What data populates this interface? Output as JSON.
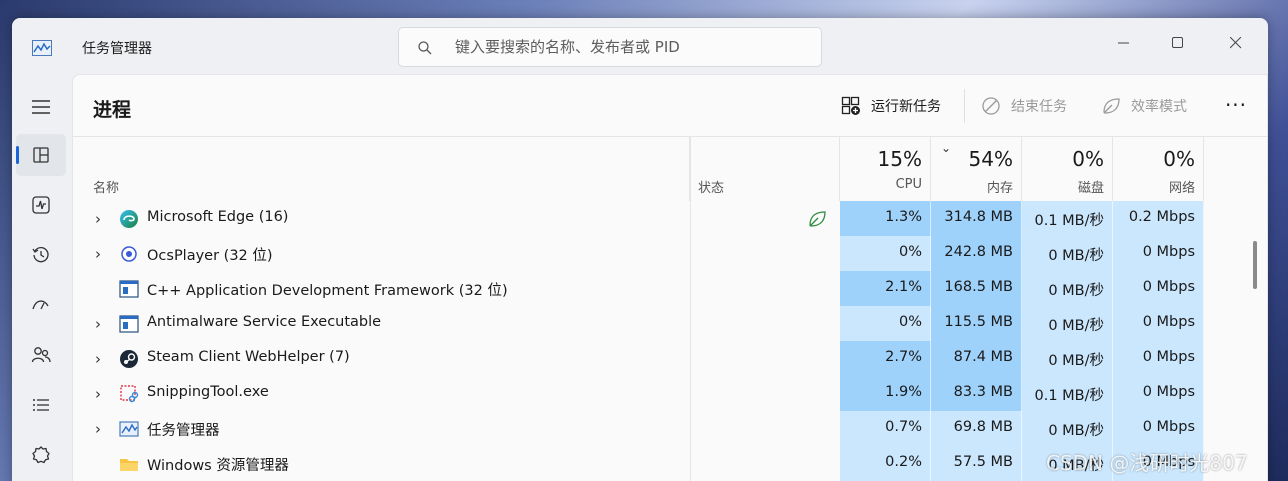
{
  "app": {
    "title": "任务管理器"
  },
  "search": {
    "placeholder": "键入要搜索的名称、发布者或 PID"
  },
  "page": {
    "title": "进程"
  },
  "toolbar": {
    "run_new_task": "运行新任务",
    "end_task": "结束任务",
    "efficiency_mode": "效率模式",
    "more": "···"
  },
  "columns": {
    "name": "名称",
    "status": "状态",
    "cpu": {
      "pct": "15%",
      "label": "CPU"
    },
    "memory": {
      "pct": "54%",
      "label": "内存"
    },
    "disk": {
      "pct": "0%",
      "label": "磁盘"
    },
    "network": {
      "pct": "0%",
      "label": "网络"
    }
  },
  "processes": [
    {
      "name": "Microsoft Edge (16)",
      "icon": "edge-icon",
      "expandable": true,
      "status": "efficiency-leaf-icon",
      "cpu": "1.3%",
      "memory": "314.8 MB",
      "disk": "0.1 MB/秒",
      "network": "0.2 Mbps"
    },
    {
      "name": "OcsPlayer (32 位)",
      "icon": "ocsplayer-icon",
      "expandable": true,
      "status": "",
      "cpu": "0%",
      "memory": "242.8 MB",
      "disk": "0 MB/秒",
      "network": "0 Mbps"
    },
    {
      "name": "C++ Application Development Framework (32 位)",
      "icon": "window-icon",
      "expandable": false,
      "status": "",
      "cpu": "2.1%",
      "memory": "168.5 MB",
      "disk": "0 MB/秒",
      "network": "0 Mbps"
    },
    {
      "name": "Antimalware Service Executable",
      "icon": "window-icon",
      "expandable": true,
      "status": "",
      "cpu": "0%",
      "memory": "115.5 MB",
      "disk": "0 MB/秒",
      "network": "0 Mbps"
    },
    {
      "name": "Steam Client WebHelper (7)",
      "icon": "steam-icon",
      "expandable": true,
      "status": "",
      "cpu": "2.7%",
      "memory": "87.4 MB",
      "disk": "0 MB/秒",
      "network": "0 Mbps"
    },
    {
      "name": "SnippingTool.exe",
      "icon": "snipping-tool-icon",
      "expandable": true,
      "status": "",
      "cpu": "1.9%",
      "memory": "83.3 MB",
      "disk": "0.1 MB/秒",
      "network": "0 Mbps"
    },
    {
      "name": "任务管理器",
      "icon": "task-manager-icon",
      "expandable": true,
      "status": "",
      "cpu": "0.7%",
      "memory": "69.8 MB",
      "disk": "0 MB/秒",
      "network": "0 Mbps"
    },
    {
      "name": "Windows 资源管理器",
      "icon": "folder-icon",
      "expandable": false,
      "status": "",
      "cpu": "0.2%",
      "memory": "57.5 MB",
      "disk": "0 MB/秒",
      "network": "0 Mbps"
    }
  ],
  "heat_colors": {
    "strong": "#9fd2fb",
    "light": "#cbe7fd"
  },
  "watermark": "CSDN @浅研时光807"
}
